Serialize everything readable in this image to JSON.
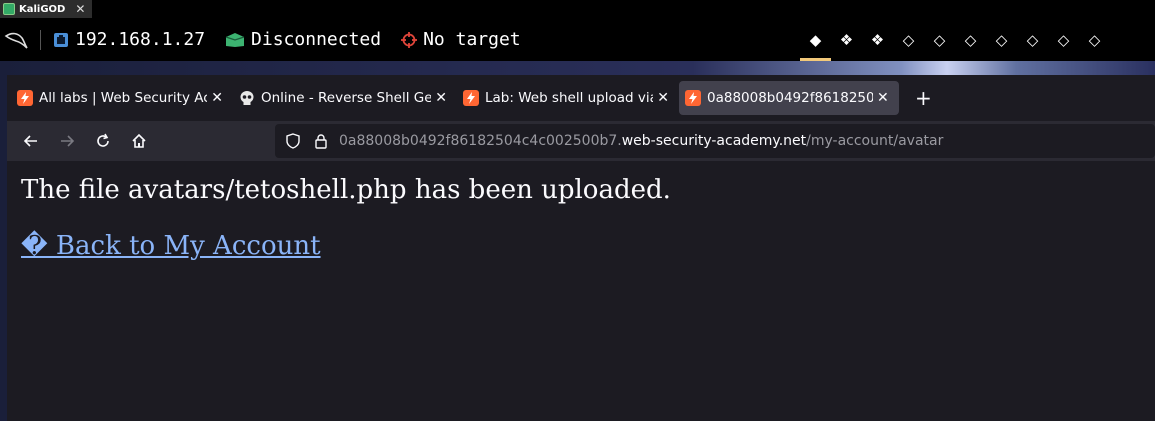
{
  "wm": {
    "title": "KaliGOD",
    "close": "✕"
  },
  "panel": {
    "ip": "192.168.1.27",
    "vpn_status": "Disconnected",
    "target": "No target",
    "workspaces": [
      "◆",
      "❖",
      "❖",
      "◇",
      "◇",
      "◇",
      "◇",
      "◇",
      "◇",
      "◇"
    ]
  },
  "browser": {
    "tabs": [
      {
        "label": "All labs | Web Security Ac",
        "close": "✕",
        "favicon": "portswigger-icon"
      },
      {
        "label": "Online - Reverse Shell Ge",
        "close": "✕",
        "favicon": "skull-icon"
      },
      {
        "label": "Lab: Web shell upload via",
        "close": "✕",
        "favicon": "portswigger-icon"
      },
      {
        "label": "0a88008b0492f8618250",
        "close": "✕",
        "favicon": "portswigger-icon"
      }
    ],
    "new_tab": "+",
    "url": {
      "prefix": "0a88008b0492f86182504c4c002500b7.",
      "domain": "web-security-academy.net",
      "path": "/my-account/avatar"
    }
  },
  "page": {
    "message": "The file avatars/tetoshell.php has been uploaded.",
    "back_link": "� Back to My Account"
  },
  "colors": {
    "accent": "#f2c97a",
    "link": "#8ab4f8",
    "vpn_icon": "#3cb371",
    "target_icon": "#e0453a",
    "portswigger": "#ff6633"
  }
}
